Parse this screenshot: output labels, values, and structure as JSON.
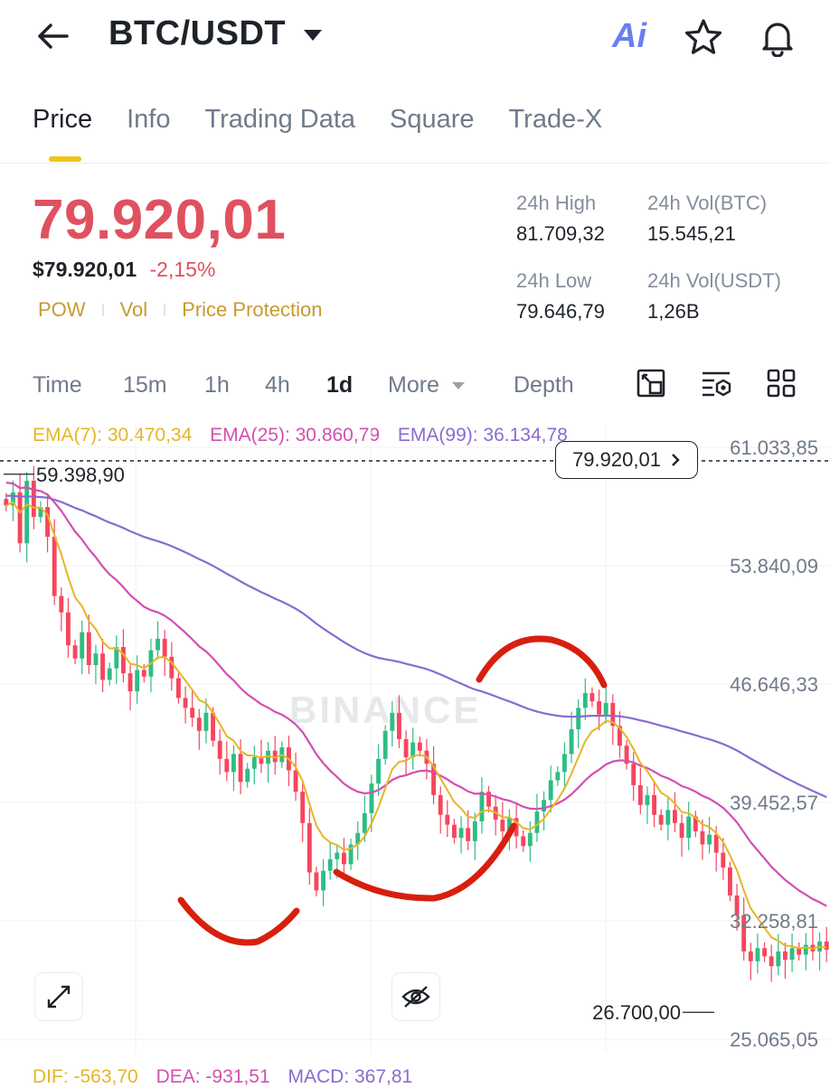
{
  "header": {
    "pair": "BTC/USDT",
    "icons": [
      "back-arrow-icon",
      "caret-down-icon",
      "ai-icon",
      "star-icon",
      "bell-icon"
    ],
    "ai_label": "Ai"
  },
  "tabs": [
    {
      "label": "Price",
      "active": true
    },
    {
      "label": "Info"
    },
    {
      "label": "Trading Data"
    },
    {
      "label": "Square"
    },
    {
      "label": "Trade-X"
    }
  ],
  "ticker": {
    "last_price": "79.920,01",
    "usd_price": "$79.920,01",
    "change": "-2,15%",
    "badges": [
      "POW",
      "Vol",
      "Price Protection"
    ],
    "high_label": "24h High",
    "high_value": "81.709,32",
    "vol_btc_label": "24h Vol(BTC)",
    "vol_btc_value": "15.545,21",
    "low_label": "24h Low",
    "low_value": "79.646,79",
    "vol_usdt_label": "24h Vol(USDT)",
    "vol_usdt_value": "1,26B"
  },
  "timeframes": {
    "items": [
      "Time",
      "15m",
      "1h",
      "4h",
      "1d",
      "More",
      "Depth"
    ],
    "selected": "1d",
    "tool_icons": [
      "chart-fullscreen-icon",
      "indicator-settings-icon",
      "grid-layout-icon"
    ]
  },
  "indicators": {
    "ema7": "EMA(7): 30.470,34",
    "ema25": "EMA(25): 30.860,79",
    "ema99": "EMA(99): 36.134,78",
    "ema7_color": "#e6b527",
    "ema25_color": "#d34fb1",
    "ema99_color": "#8a6bd0"
  },
  "chart_data": {
    "type": "candlestick",
    "y_axis_ticks": [
      "61.033,85",
      "53.840,09",
      "46.646,33",
      "39.452,57",
      "32.258,81",
      "25.065,05"
    ],
    "ylim": [
      25065.05,
      61033.85
    ],
    "current_price_tag": "79.920,01",
    "high_marker": "59.398,90",
    "low_marker": "26.700,00",
    "watermark": "BINANCE",
    "up_color": "#2ebd85",
    "down_color": "#f6465d",
    "annotation_color": "#d81f0f",
    "candles_close": [
      57500,
      58300,
      55200,
      59000,
      56800,
      57400,
      55600,
      52000,
      51000,
      49000,
      48200,
      49800,
      47800,
      48500,
      46900,
      47600,
      48900,
      47300,
      46200,
      47500,
      47100,
      48700,
      49400,
      48300,
      47000,
      45800,
      45200,
      44600,
      43800,
      44900,
      43200,
      42100,
      41300,
      42400,
      40700,
      41500,
      42200,
      41800,
      42600,
      41900,
      42800,
      41400,
      40100,
      38200,
      35200,
      34100,
      35300,
      36000,
      36400,
      35700,
      36900,
      37600,
      38800,
      40600,
      42100,
      43800,
      44900,
      43300,
      42200,
      43100,
      42600,
      41800,
      39900,
      38700,
      38100,
      37300,
      37900,
      37100,
      38300,
      40100,
      39200,
      38400,
      37700,
      38500,
      37400,
      36800,
      37600,
      38900,
      39600,
      40800,
      41300,
      42400,
      43900,
      45200,
      46100,
      45600,
      44800,
      45500,
      44100,
      42900,
      41800,
      40500,
      39300,
      39900,
      38700,
      38100,
      39000,
      38200,
      37300,
      38600,
      37700,
      36900,
      37500,
      36400,
      35500,
      33800,
      32600,
      30400,
      29800,
      30600,
      30100,
      29500,
      30400,
      29900,
      30600,
      30200,
      30800,
      30400,
      31000,
      30500
    ]
  },
  "macd": {
    "dif": "DIF: -563,70",
    "dea": "DEA: -931,51",
    "macd": "MACD: 367,81"
  }
}
